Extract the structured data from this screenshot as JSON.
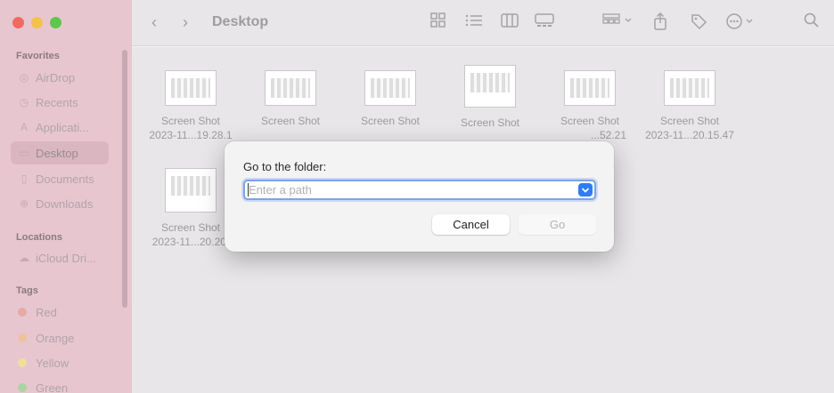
{
  "window": {
    "title": "Desktop"
  },
  "sidebar": {
    "sections": [
      {
        "label": "Favorites",
        "items": [
          {
            "label": "AirDrop",
            "icon": "airdrop-icon"
          },
          {
            "label": "Recents",
            "icon": "clock-icon"
          },
          {
            "label": "Applicati...",
            "icon": "applications-icon"
          },
          {
            "label": "Desktop",
            "icon": "desktop-icon",
            "active": true
          },
          {
            "label": "Documents",
            "icon": "document-icon"
          },
          {
            "label": "Downloads",
            "icon": "download-icon"
          }
        ]
      },
      {
        "label": "Locations",
        "items": [
          {
            "label": "iCloud Dri...",
            "icon": "cloud-icon"
          }
        ]
      },
      {
        "label": "Tags",
        "items": [
          {
            "label": "Red",
            "color": "#e25c5c"
          },
          {
            "label": "Orange",
            "color": "#f0a24a"
          },
          {
            "label": "Yellow",
            "color": "#f2d34a"
          },
          {
            "label": "Green",
            "color": "#5bbf57"
          }
        ]
      }
    ]
  },
  "files": [
    {
      "line1": "Screen Shot",
      "line2": "2023-11...19.28.1"
    },
    {
      "line1": "Screen Shot",
      "line2": ""
    },
    {
      "line1": "Screen Shot",
      "line2": ""
    },
    {
      "line1": "Screen Shot",
      "line2": ""
    },
    {
      "line1": "Screen Shot",
      "line2": "...52.21"
    },
    {
      "line1": "Screen Shot",
      "line2": "2023-11...20.15.47"
    },
    {
      "line1": "Screen Shot",
      "line2": "2023-11...20.20."
    }
  ],
  "dialog": {
    "title": "Go to the folder:",
    "input_placeholder": "Enter a path",
    "input_value": "",
    "cancel_label": "Cancel",
    "go_label": "Go"
  },
  "colors": {
    "accent": "#2f7cf6",
    "focus_ring": "#7aa5e6"
  }
}
